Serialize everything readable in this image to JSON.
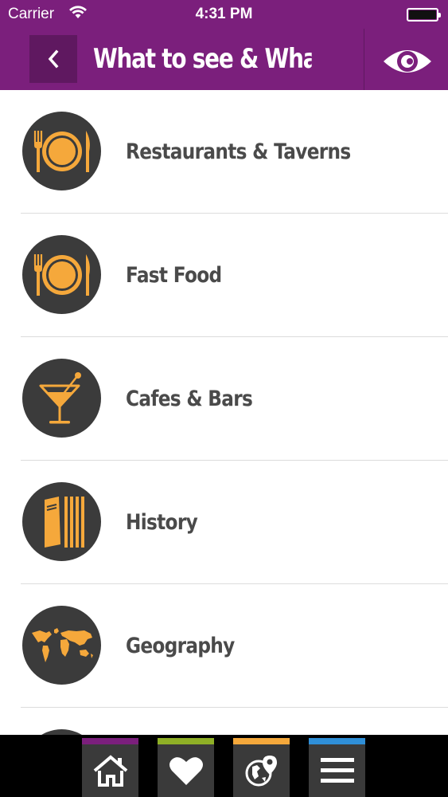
{
  "status_bar": {
    "carrier": "Carrier",
    "time": "4:31 PM"
  },
  "header": {
    "title": "What to see & What t...",
    "background_color": "#7b1f7c",
    "back_icon": "chevron-left-icon",
    "action_icon": "eye-icon"
  },
  "list": {
    "items": [
      {
        "label": "Restaurants & Taverns",
        "icon": "plate-cutlery-icon"
      },
      {
        "label": "Fast Food",
        "icon": "plate-cutlery-icon"
      },
      {
        "label": "Cafes & Bars",
        "icon": "cocktail-glass-icon"
      },
      {
        "label": "History",
        "icon": "books-icon"
      },
      {
        "label": "Geography",
        "icon": "world-map-icon"
      }
    ],
    "icon_color": "#f5a83b",
    "circle_color": "#3b3b3b"
  },
  "tabbar": {
    "tabs": [
      {
        "icon": "home-icon",
        "accent": "#7b1f7c"
      },
      {
        "icon": "heart-icon",
        "accent": "#8fb026"
      },
      {
        "icon": "globe-pin-icon",
        "accent": "#f5a83b"
      },
      {
        "icon": "menu-icon",
        "accent": "#2f8fd8"
      }
    ]
  }
}
